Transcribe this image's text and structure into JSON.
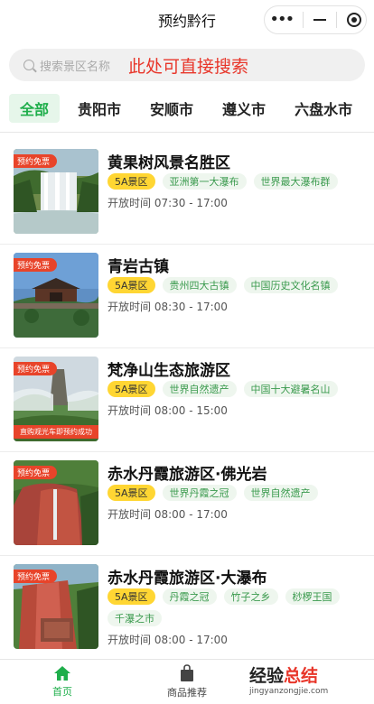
{
  "header": {
    "title": "预约黔行"
  },
  "search": {
    "placeholder": "搜索景区名称",
    "hint": "此处可直接搜索"
  },
  "tabs": [
    {
      "label": "全部",
      "active": true
    },
    {
      "label": "贵阳市",
      "active": false
    },
    {
      "label": "安顺市",
      "active": false
    },
    {
      "label": "遵义市",
      "active": false
    },
    {
      "label": "六盘水市",
      "active": false
    }
  ],
  "ribbon_text": "预约免票",
  "scenic_list": [
    {
      "name": "黄果树风景名胜区",
      "tags": [
        "5A景区",
        "亚洲第一大瀑布",
        "世界最大瀑布群"
      ],
      "hours": "开放时间  07:30 - 17:00"
    },
    {
      "name": "青岩古镇",
      "tags": [
        "5A景区",
        "贵州四大古镇",
        "中国历史文化名镇"
      ],
      "hours": "开放时间  08:30 - 17:00"
    },
    {
      "name": "梵净山生态旅游区",
      "tags": [
        "5A景区",
        "世界自然遗产",
        "中国十大避暑名山"
      ],
      "hours": "开放时间  08:00 - 15:00",
      "bottom_banner": "直购观光车即预约成功"
    },
    {
      "name": "赤水丹霞旅游区·佛光岩",
      "tags": [
        "5A景区",
        "世界丹霞之冠",
        "世界自然遗产"
      ],
      "hours": "开放时间  08:00 - 17:00"
    },
    {
      "name": "赤水丹霞旅游区·大瀑布",
      "tags": [
        "5A景区",
        "丹霞之冠",
        "竹子之乡",
        "桫椤王国",
        "千瀑之市"
      ],
      "hours": "开放时间  08:00 - 17:00"
    }
  ],
  "tabbar": {
    "items": [
      {
        "label": "首页",
        "icon": "home-icon",
        "active": true
      },
      {
        "label": "商品推荐",
        "icon": "shopping-bag-icon",
        "active": false
      }
    ]
  },
  "watermark": {
    "part1": "经验",
    "part2": "总结",
    "url": "jingyanzongjie.com"
  },
  "colors": {
    "accent": "#1fae4b",
    "ribbon": "#e8442a",
    "level_tag": "#ffd633",
    "hint": "#e8362a"
  }
}
